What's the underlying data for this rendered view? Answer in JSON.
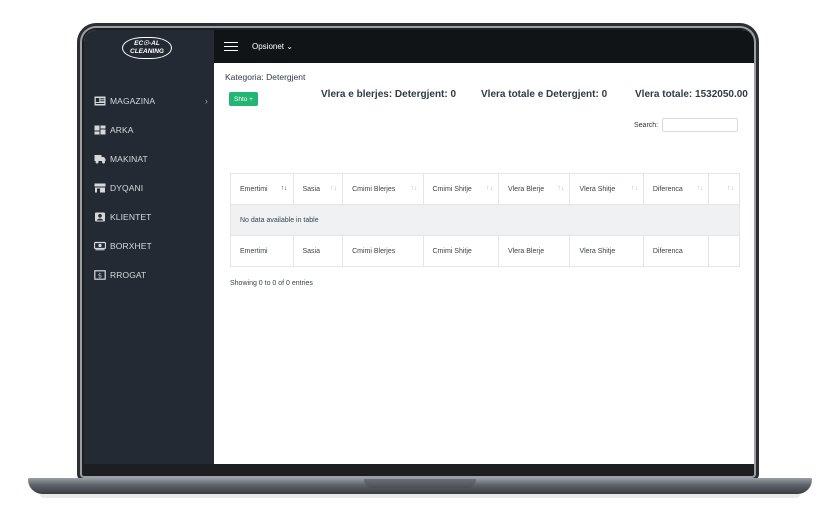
{
  "brand": {
    "logo_line1": "EC☉-AL",
    "logo_line2": "CLEANING"
  },
  "sidebar": {
    "items": [
      {
        "label": "MAGAZINA",
        "icon": "id-card-icon",
        "has_submenu": true
      },
      {
        "label": "ARKA",
        "icon": "dashboard-icon",
        "has_submenu": false
      },
      {
        "label": "MAKINAT",
        "icon": "truck-icon",
        "has_submenu": false
      },
      {
        "label": "DYQANI",
        "icon": "store-icon",
        "has_submenu": false
      },
      {
        "label": "KLIENTET",
        "icon": "user-box-icon",
        "has_submenu": false
      },
      {
        "label": "BORXHET",
        "icon": "money-icon",
        "has_submenu": false
      },
      {
        "label": "RROGAT",
        "icon": "banknote-icon",
        "has_submenu": false
      }
    ]
  },
  "topbar": {
    "menu_label": "Opsionet ⌄",
    "hamburger_icon": "hamburger-icon"
  },
  "page": {
    "category_title": "Kategoria: Detergjent",
    "add_button": "Shto +",
    "stat_purchase": "Vlera e blerjes: Detergjent: 0",
    "stat_total_category": "Vlera totale e Detergjent: 0",
    "stat_total": "Vlera totale: 1532050.00"
  },
  "table": {
    "search_label": "Search:",
    "search_value": "",
    "columns": [
      "Emertimi",
      "Sasia",
      "Cmimi Blerjes",
      "Cmimi Shitje",
      "Vlera Blerje",
      "Vlera Shitje",
      "Diferenca",
      ""
    ],
    "empty_text": "No data available in table",
    "info": "Showing 0 to 0 of 0 entries"
  },
  "colors": {
    "sidebar": "#232a33",
    "topbar": "#111417",
    "accent": "#22b573"
  }
}
